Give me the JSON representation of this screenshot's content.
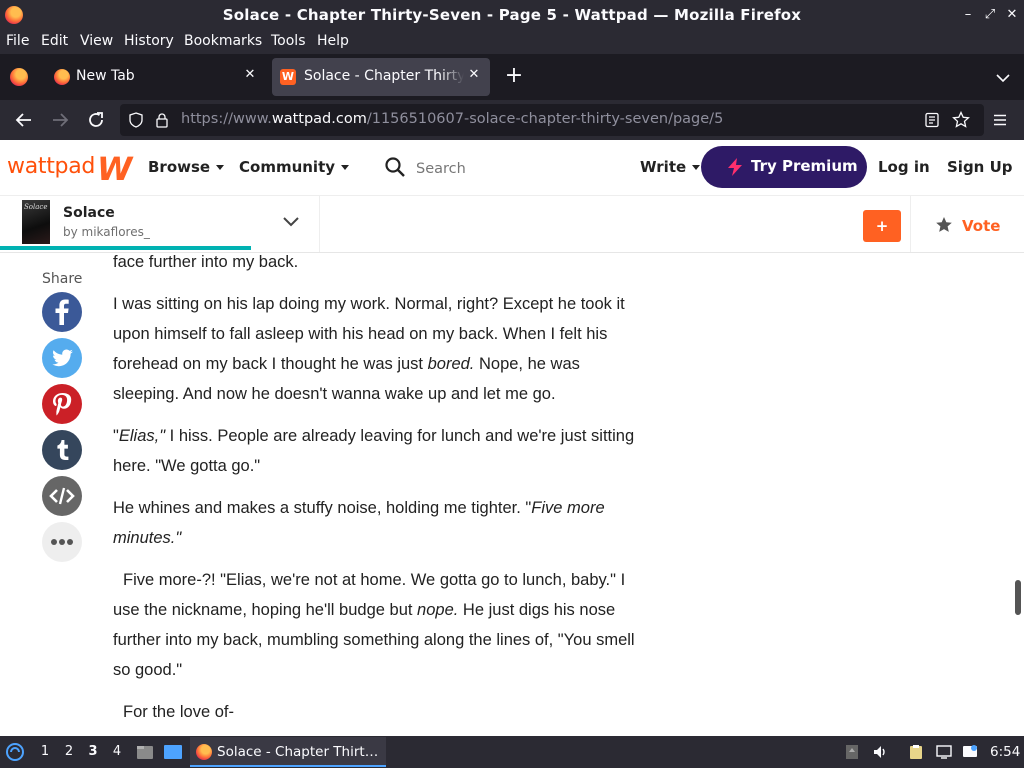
{
  "window": {
    "title": "Solace - Chapter Thirty-Seven - Page 5 - Wattpad — Mozilla Firefox",
    "minimize_glyph": "–",
    "restore_glyph": "⤢",
    "close_glyph": "✕"
  },
  "menubar": [
    "File",
    "Edit",
    "View",
    "History",
    "Bookmarks",
    "Tools",
    "Help"
  ],
  "tabs": [
    {
      "label": "New Tab",
      "active": false
    },
    {
      "label": "Solace - Chapter Thirty-Seven",
      "active": true
    }
  ],
  "tab_close_glyph": "✕",
  "new_tab_glyph": "+",
  "urlbar": {
    "prefix": "https://www.",
    "domain": "wattpad.com",
    "path": "/1156510607-solace-chapter-thirty-seven/page/5"
  },
  "wattpad": {
    "logo_text": "wattpad",
    "logo_mark": "W",
    "nav": [
      "Browse",
      "Community"
    ],
    "search_placeholder": "Search",
    "write_label": "Write",
    "premium_label": "Try Premium",
    "login_label": "Log in",
    "signup_label": "Sign Up",
    "brand_color": "#ff6122",
    "premium_color": "#2e1a66"
  },
  "story": {
    "cover_text": "Solace",
    "title": "Solace",
    "author": "by mikaflores_",
    "progress_fraction": 0.785,
    "add_label": "+",
    "vote_label": "Vote"
  },
  "share": {
    "label": "Share",
    "buttons": [
      {
        "name": "facebook",
        "color": "#3b5998"
      },
      {
        "name": "twitter",
        "color": "#55acee"
      },
      {
        "name": "pinterest",
        "color": "#cb2027"
      },
      {
        "name": "tumblr",
        "color": "#35465c"
      },
      {
        "name": "embed",
        "color": "#666666"
      },
      {
        "name": "more",
        "color": "#eeeeee"
      }
    ]
  },
  "paragraphs": {
    "p0": "face further into my back.",
    "p1": "I was sitting on his lap doing my work. Normal, right? Except he took it upon himself to fall asleep with his head on my back. When I felt his forehead on my back I thought he was just ",
    "p1_em": "bored.",
    "p1_end": " Nope, he was sleeping. And now he doesn't wanna wake up and let me go.",
    "p2_start": "\"",
    "p2_em": "Elias,\"",
    "p2_end": " I hiss. People are already leaving for lunch and we're just sitting here. \"We gotta go.\"",
    "p3": "He whines and makes a stuffy noise, holding me tighter. \"",
    "p3_em": "Five more minutes.\"",
    "p4": "Five more-?! \"Elias, we're not at home. We gotta go to lunch, baby.\" I use the nickname, hoping he'll budge but ",
    "p4_em": "nope.",
    "p4_end": " He just digs his nose further into my back, mumbling something along the lines of, \"You smell so good.\"",
    "p5": "For the love of-"
  },
  "taskbar": {
    "workspaces": [
      "1",
      "2",
      "3",
      "4"
    ],
    "active_workspace": "3",
    "app_label": "Solace - Chapter Thirt…",
    "clock": "6:54"
  }
}
